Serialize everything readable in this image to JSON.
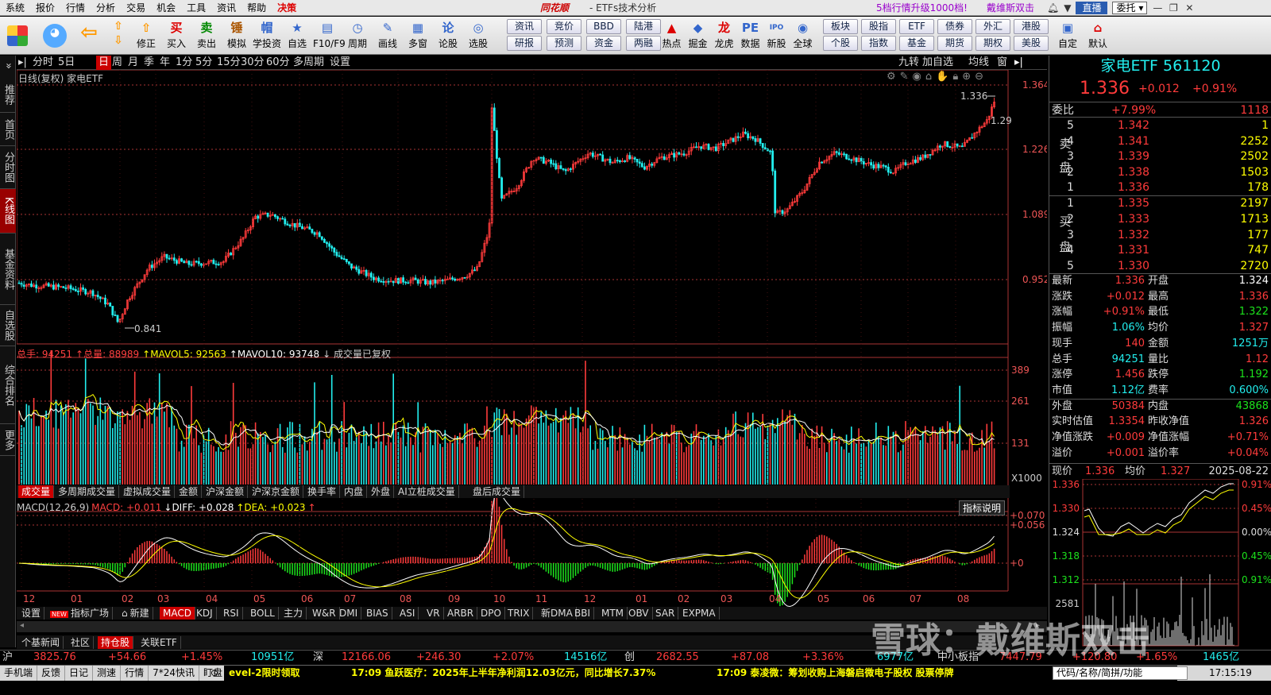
{
  "menubar": {
    "items": [
      "系统",
      "报价",
      "行情",
      "分析",
      "交易",
      "机会",
      "工具",
      "资讯",
      "帮助",
      "决策"
    ],
    "brand": "同花顺",
    "subtitle": "- ETFs技术分析",
    "promo": "5档行情升级1000档!",
    "user": "戴维斯双击",
    "btn_guide": "直播",
    "btn_entrust": "委托"
  },
  "toolbar": {
    "big": [
      {
        "label": "修正",
        "icon": "⇧"
      },
      {
        "label": "买入",
        "icon": "买"
      },
      {
        "label": "卖出",
        "icon": "卖"
      },
      {
        "label": "模拟",
        "icon": "锤"
      },
      {
        "label": "学投资",
        "icon": "帽"
      },
      {
        "label": "自选",
        "icon": "★"
      },
      {
        "label": "F10/F9",
        "icon": "▤"
      },
      {
        "label": "周期",
        "icon": "◷"
      },
      {
        "label": "画线",
        "icon": "✎"
      },
      {
        "label": "多窗",
        "icon": "▦"
      },
      {
        "label": "论股",
        "icon": "论"
      },
      {
        "label": "选股",
        "icon": "◎"
      }
    ],
    "grid": [
      [
        "资讯",
        "竞价",
        "BBD",
        "陆港"
      ],
      [
        "研报",
        "预测",
        "资金",
        "两融"
      ]
    ],
    "big2": [
      {
        "label": "热点",
        "icon": "▲"
      },
      {
        "label": "掘金",
        "icon": "◆"
      },
      {
        "label": "龙虎",
        "icon": "龙"
      },
      {
        "label": "数据",
        "icon": "PE"
      },
      {
        "label": "新股",
        "icon": "IPO"
      },
      {
        "label": "全球",
        "icon": "◉"
      }
    ],
    "grid2": [
      [
        "板块",
        "股指",
        "ETF",
        "债券",
        "外汇",
        "港股"
      ],
      [
        "个股",
        "指数",
        "基金",
        "期货",
        "期权",
        "美股"
      ]
    ],
    "big3": [
      {
        "label": "自定",
        "icon": "▣"
      },
      {
        "label": "默认",
        "icon": "⌂"
      }
    ]
  },
  "lefttabs": [
    "推荐",
    "首页",
    "分时图",
    "K线图",
    "基金资料",
    "自选股",
    "综合排名",
    "更多"
  ],
  "periods": {
    "items": [
      "分时",
      "5日",
      "日",
      "周",
      "月",
      "季",
      "年",
      "1分",
      "5分",
      "15分",
      "30分",
      "60分",
      "多周期",
      "设置"
    ],
    "active": "日",
    "right": [
      "九转",
      "加自选",
      "均线",
      "窗"
    ]
  },
  "kchart": {
    "title": "日线(复权) 家电ETF",
    "price_labels": [
      "1.364",
      "1.226",
      "1.089",
      "0.952"
    ],
    "high_note": "1.336",
    "right_note": "1.29",
    "low_note": "0.841",
    "month_labels": [
      "12",
      "01",
      "02",
      "03",
      "04",
      "05",
      "06",
      "07",
      "08",
      "09",
      "10",
      "11",
      "12",
      "01",
      "02",
      "03",
      "04",
      "05",
      "06",
      "07",
      "08"
    ]
  },
  "volume": {
    "header": [
      {
        "t": "总手: 94251",
        "c": "#ff4040"
      },
      {
        "t": "↑总量: 88989",
        "c": "#ff4040"
      },
      {
        "t": "↑MAVOL5: 92563",
        "c": "#ffff00"
      },
      {
        "t": "↑MAVOL10: 93748",
        "c": "#ffffff"
      },
      {
        "t": "↓ 成交量已复权",
        "c": "#cccccc"
      }
    ],
    "axis": [
      "389",
      "261",
      "131",
      "X1000"
    ],
    "tabs": [
      "成交量",
      "多周期成交量",
      "虚拟成交量",
      "金额",
      "沪深金额",
      "沪深京金额",
      "换手率",
      "内盘",
      "外盘",
      "AI立桩成交量",
      "盘后成交量"
    ]
  },
  "macd": {
    "header": [
      {
        "t": "MACD(12,26,9)",
        "c": "#cccccc"
      },
      {
        "t": "MACD: +0.011",
        "c": "#ff4040"
      },
      {
        "t": "↓DIFF: +0.028",
        "c": "#ffffff"
      },
      {
        "t": "↑DEA: +0.023",
        "c": "#ffff00"
      },
      {
        "t": "↑",
        "c": "#ff4040"
      }
    ],
    "axis": [
      "+0.070",
      "+0.056",
      "+0"
    ],
    "explain": "指标说明"
  },
  "indicator_tabs": [
    "设置",
    "指标广场",
    "新建",
    "MACD",
    "KDJ",
    "RSI",
    "BOLL",
    "主力",
    "W&R",
    "DMI",
    "BIAS",
    "ASI",
    "VR",
    "ARBR",
    "DPO",
    "TRIX",
    "新DMA",
    "BBI",
    "MTM",
    "OBV",
    "SAR",
    "EXPMA"
  ],
  "news_tabs": [
    "个基新闻",
    "社区",
    "持仓股",
    "关联ETF"
  ],
  "quote": {
    "name": "家电ETF 561120",
    "price": "1.336",
    "change": "+0.012",
    "pct": "+0.91%",
    "weibi_label": "委比",
    "weibi": "+7.99%",
    "weicha": "1118",
    "sell": [
      {
        "l": "5",
        "p": "1.342",
        "v": "1"
      },
      {
        "l": "4",
        "p": "1.341",
        "v": "2252"
      },
      {
        "l": "3",
        "p": "1.339",
        "v": "2502"
      },
      {
        "l": "2",
        "p": "1.338",
        "v": "1503"
      },
      {
        "l": "1",
        "p": "1.336",
        "v": "178"
      }
    ],
    "buy": [
      {
        "l": "1",
        "p": "1.335",
        "v": "2197"
      },
      {
        "l": "2",
        "p": "1.333",
        "v": "1713"
      },
      {
        "l": "3",
        "p": "1.332",
        "v": "177"
      },
      {
        "l": "4",
        "p": "1.331",
        "v": "747"
      },
      {
        "l": "5",
        "p": "1.330",
        "v": "2720"
      }
    ],
    "sell_label": "卖盘",
    "buy_label": "买盘",
    "stats": [
      [
        "最新",
        "1.336",
        "red",
        "开盘",
        "1.324",
        "wht"
      ],
      [
        "涨跌",
        "+0.012",
        "red",
        "最高",
        "1.336",
        "red"
      ],
      [
        "涨幅",
        "+0.91%",
        "red",
        "最低",
        "1.322",
        "grn"
      ],
      [
        "振幅",
        "1.06%",
        "cyn",
        "均价",
        "1.327",
        "red"
      ],
      [
        "现手",
        "140",
        "red",
        "金额",
        "1251万",
        "cyn"
      ],
      [
        "总手",
        "94251",
        "cyn",
        "量比",
        "1.12",
        "red"
      ],
      [
        "涨停",
        "1.456",
        "red",
        "跌停",
        "1.192",
        "grn"
      ],
      [
        "市值",
        "1.12亿",
        "cyn",
        "费率",
        "0.600%",
        "cyn"
      ],
      [
        "外盘",
        "50384",
        "red",
        "内盘",
        "43868",
        "grn"
      ],
      [
        "实时估值",
        "1.3354",
        "red",
        "昨收净值",
        "1.326",
        "red"
      ],
      [
        "净值涨跌",
        "+0.009",
        "red",
        "净值涨幅",
        "+0.71%",
        "red"
      ],
      [
        "溢价",
        "+0.001",
        "red",
        "溢价率",
        "+0.04%",
        "red"
      ]
    ],
    "mini_header": {
      "a": "现价",
      "b": "1.336",
      "c": "均价",
      "d": "1.327",
      "e": "2025-08-22"
    },
    "mini_left": [
      "1.336",
      "1.330",
      "1.324",
      "1.318",
      "1.312",
      "2581"
    ],
    "mini_right": [
      "0.91%",
      "0.45%",
      "0.00%",
      "0.45%",
      "0.91%"
    ]
  },
  "stockbar": {
    "sh_label": "沪",
    "sh": "3825.76",
    "sh_ch": "+54.66",
    "sh_pct": "+1.45%",
    "sh_amt": "10951亿",
    "sz_label": "深",
    "sz": "12166.06",
    "sz_ch": "+246.30",
    "sz_pct": "+2.07%",
    "sz_amt": "14516亿",
    "cy_label": "创",
    "cy": "2682.55",
    "cy_ch": "+87.08",
    "cy_pct": "+3.36%",
    "cy_amt": "6977亿",
    "zx_label": "中小板指",
    "zx": "7447.79",
    "zx_ch": "+120.80",
    "zx_pct": "+1.65%",
    "zx_amt": "1465亿"
  },
  "statusbar": {
    "items": [
      "手机端",
      "反馈",
      "日记",
      "测速",
      "行情",
      "7*24快讯",
      "盯盘"
    ],
    "ticker1": "evel-2限时领取",
    "ticker2": "17:09 鱼跃医疗：2025年上半年净利润12.03亿元，同比增长7.37%",
    "ticker3": "17:09 泰凌微：筹划收购上海磐启微电子股权 股票停牌",
    "search": "代码/名称/简拼/功能",
    "time": "17:15:19"
  },
  "watermark": "雪球：戴维斯双击"
}
